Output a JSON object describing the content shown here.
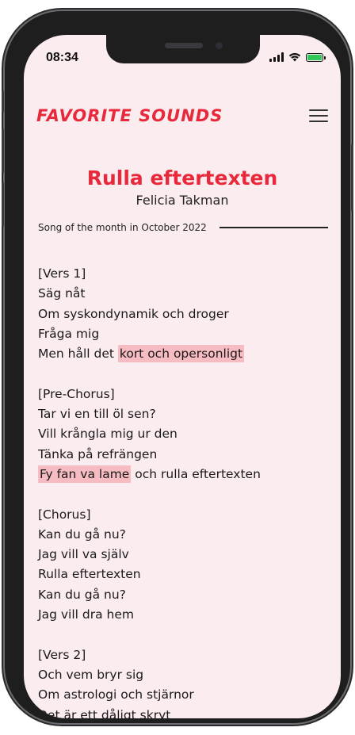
{
  "status_bar": {
    "time": "08:34",
    "signal_icon": "cellular-signal-icon",
    "wifi_icon": "wifi-icon",
    "battery_icon": "battery-icon",
    "battery_color": "#32c759"
  },
  "header": {
    "logo_text": "Favorite Sounds",
    "menu_icon": "hamburger-menu-icon",
    "accent_color": "#e8293b"
  },
  "song": {
    "title": "Rulla eftertexten",
    "artist": "Felicia Takman",
    "song_of_month": "Song of the month in October 2022"
  },
  "lyrics": {
    "vers1": {
      "label": "[Vers 1]",
      "line1": "Säg nåt",
      "line2": "Om syskondynamik och droger",
      "line3": "Fråga mig",
      "line4_plain": "Men håll det ",
      "line4_highlight": "kort och opersonligt"
    },
    "prechorus": {
      "label": "[Pre-Chorus]",
      "line1": "Tar vi en till öl sen?",
      "line2": "Vill krångla mig ur den",
      "line3": "Tänka på refrängen",
      "line4_highlight": "Fy fan va lame",
      "line4_plain": " och rulla eftertexten"
    },
    "chorus": {
      "label": "[Chorus]",
      "line1": "Kan du gå nu?",
      "line2": "Jag vill va själv",
      "line3": "Rulla eftertexten",
      "line4": "Kan du gå nu?",
      "line5": "Jag vill dra hem"
    },
    "vers2": {
      "label": "[Vers 2]",
      "line1": "Och vem bryr sig",
      "line2": "Om astrologi och stjärnor",
      "line3": "Det är ett dåligt skryt"
    },
    "highlight_color": "#f7bcc2"
  }
}
